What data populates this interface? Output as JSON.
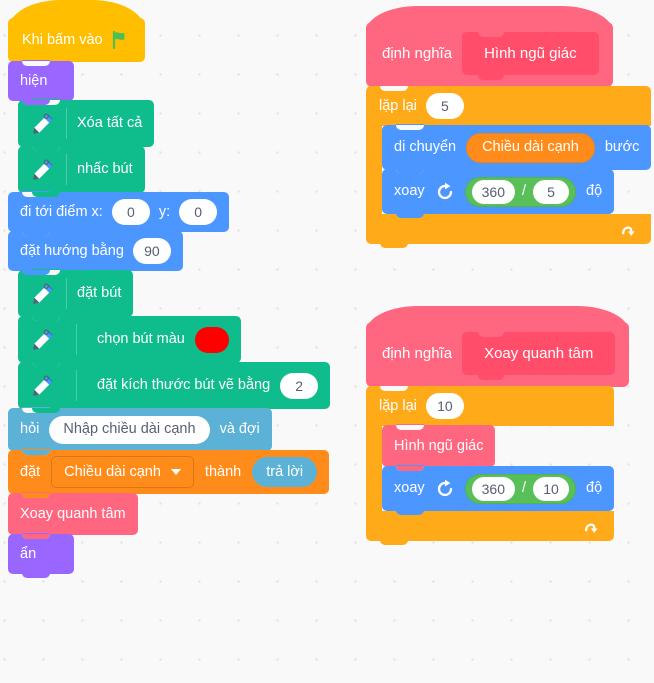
{
  "workspace": {
    "background_color": "#f9f9f9",
    "dot_color": "#e0e0e0"
  },
  "palette": {
    "events": "#FFBF00",
    "looks": "#9966FF",
    "pen": "#0FBD8C",
    "motion": "#4C97FF",
    "sensing": "#5CB1D6",
    "variables": "#FF8C1A",
    "control": "#FFAB19",
    "my_blocks": "#FF6680",
    "my_blocks_proto": "#FF4D6A",
    "operators": "#59C059",
    "pen_color_value": "#FF0000"
  },
  "scripts": {
    "main": {
      "hat": {
        "label": "Khi bấm vào",
        "icon": "green-flag-icon"
      },
      "blocks": [
        {
          "id": "show",
          "label": "hiện"
        },
        {
          "id": "erase-all",
          "icon": "pen-icon",
          "label": "Xóa tất cả"
        },
        {
          "id": "pen-up",
          "icon": "pen-icon",
          "label": "nhấc bút"
        },
        {
          "id": "goto-xy",
          "label_x": "đi tới điểm x:",
          "value_x": "0",
          "label_y": "y:",
          "value_y": "0"
        },
        {
          "id": "point-dir",
          "label": "đặt hướng bằng",
          "value": "90"
        },
        {
          "id": "pen-down",
          "icon": "pen-icon",
          "label": "đặt bút"
        },
        {
          "id": "set-pen-color",
          "icon": "pen-icon",
          "label": "chọn bút màu",
          "color": "#FF0000"
        },
        {
          "id": "set-pen-size",
          "icon": "pen-icon",
          "label": "đặt kích thước bút vẽ bằng",
          "value": "2"
        },
        {
          "id": "ask",
          "label_pre": "hỏi",
          "value": "Nhập chiều dài cạnh",
          "label_post": "và đợi"
        },
        {
          "id": "set-var",
          "label_pre": "đặt",
          "variable": "Chiều dài cạnh",
          "label_mid": "thành",
          "reporter": "trả lời"
        },
        {
          "id": "call-xoay",
          "label": "Xoay quanh tâm"
        },
        {
          "id": "hide",
          "label": "ẩn"
        }
      ]
    },
    "define_pentagon": {
      "define_label": "định nghĩa",
      "proto_name": "Hình ngũ giác",
      "repeat": {
        "label": "lặp lại",
        "count": "5",
        "loop_icon": "loop-arrow-icon",
        "body": [
          {
            "id": "move",
            "label_pre": "di chuyển",
            "reporter": "Chiều dài cạnh",
            "label_post": "bước"
          },
          {
            "id": "turn",
            "label_pre": "xoay",
            "icon": "turn-clockwise-icon",
            "op_a": "360",
            "op_sign": "/",
            "op_b": "5",
            "label_post": "độ"
          }
        ]
      }
    },
    "define_rotate": {
      "define_label": "định nghĩa",
      "proto_name": "Xoay quanh tâm",
      "repeat": {
        "label": "lặp lại",
        "count": "10",
        "loop_icon": "loop-arrow-icon",
        "body": [
          {
            "id": "call-pentagon",
            "label": "Hình ngũ giác"
          },
          {
            "id": "turn",
            "label_pre": "xoay",
            "icon": "turn-clockwise-icon",
            "op_a": "360",
            "op_sign": "/",
            "op_b": "10",
            "label_post": "độ"
          }
        ]
      }
    }
  }
}
